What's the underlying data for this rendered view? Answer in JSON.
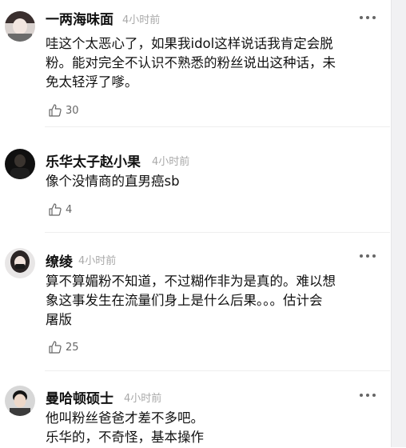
{
  "comments": [
    {
      "username": "一两海味面",
      "time": "4小时前",
      "lines": [
        "哇这个太恶心了，如果我idol这样说话我肯定会脱",
        "粉。能对完全不认识不熟悉的粉丝说出这种话，未",
        "免太轻浮了嗲。"
      ],
      "likes": "30",
      "avatar_icon": "avatar-icon"
    },
    {
      "username": "乐华太子赵小果",
      "time": "4小时前",
      "lines": [
        "像个没情商的直男癌sb"
      ],
      "likes": "4",
      "avatar_icon": "avatar-icon"
    },
    {
      "username": "缭绫",
      "time": "4小时前",
      "lines": [
        "算不算媚粉不知道，不过糊作非为是真的。难以想",
        "象这事发生在流量们身上是什么后果。。。估计会",
        "屠版"
      ],
      "likes": "25",
      "avatar_icon": "avatar-icon"
    },
    {
      "username": "曼哈顿硕士",
      "time": "4小时前",
      "lines": [
        "他叫粉丝爸爸才差不多吧。",
        "乐华的，不奇怪，基本操作"
      ],
      "avatar_icon": "avatar-icon"
    }
  ],
  "icons": {
    "like": "thumbs-up-icon",
    "more": "more-dots-icon"
  },
  "colors": {
    "time": "#a9a9a9",
    "separator": "#eeeeee",
    "like_count": "#666666"
  }
}
